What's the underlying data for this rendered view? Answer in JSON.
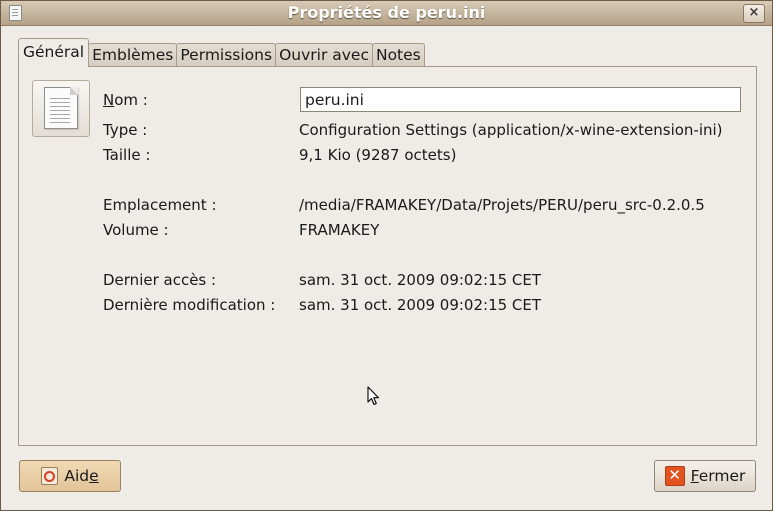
{
  "window": {
    "title": "Propriétés de peru.ini",
    "close_glyph": "×"
  },
  "tabs": [
    {
      "label": "Général",
      "active": true
    },
    {
      "label": "Emblèmes",
      "active": false
    },
    {
      "label": "Permissions",
      "active": false
    },
    {
      "label": "Ouvrir avec",
      "active": false
    },
    {
      "label": "Notes",
      "active": false
    }
  ],
  "general": {
    "name": {
      "label_mnemonic": "N",
      "label_rest": "om :",
      "value": "peru.ini"
    },
    "type": {
      "label": "Type :",
      "value": "Configuration Settings (application/x-wine-extension-ini)"
    },
    "size": {
      "label": "Taille :",
      "value": "9,1 Kio (9287 octets)"
    },
    "location": {
      "label": "Emplacement :",
      "value": "/media/FRAMAKEY/Data/Projets/PERU/peru_src-0.2.0.5"
    },
    "volume": {
      "label": "Volume :",
      "value": "FRAMAKEY"
    },
    "accessed": {
      "label": "Dernier accès :",
      "value": "sam. 31 oct. 2009 09:02:15 CET"
    },
    "modified": {
      "label": "Dernière modification :",
      "value": "sam. 31 oct. 2009 09:02:15 CET"
    }
  },
  "buttons": {
    "help": {
      "label_pre": "Aid",
      "label_mnemonic": "e",
      "icon": "help-icon"
    },
    "close": {
      "label_mnemonic": "F",
      "label_rest": "ermer",
      "icon": "close-icon"
    }
  },
  "colors": {
    "titlebar": "#c4b39c",
    "window_bg": "#efebe7",
    "close_icon": "#e2541f"
  }
}
